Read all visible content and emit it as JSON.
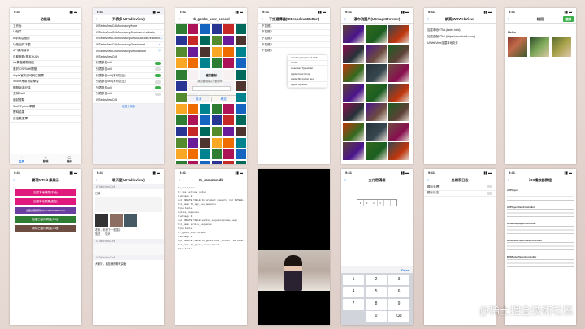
{
  "p1": {
    "time": "9:41",
    "title": "功能區",
    "items": [
      "工作台",
      "UI組件",
      "App商店推薦",
      "功能組件下載",
      "API調用接口",
      "自助服務(基本HUD)",
      "ios開發經驗總結",
      "基於IOS/Swift開發",
      "Apple官方認可商店推薦",
      "Xcode常用功能學習",
      "開發版本記錄",
      "支持Swift",
      "面試經驗",
      "Swift/Python學習",
      "實時結果",
      "自定義選擇"
    ],
    "tabs": [
      "主頁",
      "發現",
      "我的"
    ]
  },
  "p2": {
    "time": "9:41",
    "title": "列表多(UITableView)",
    "items": [
      "UITableViewCellAccessoryNone",
      "UITableViewCellAccessoryDisclosureIndicator",
      "UITableViewCellAccessoryDetailDisclosureButton",
      "UITableViewCellAccessoryCheckmark",
      "UITableViewCellAccessoryDetailButton",
      "UITableViewCell",
      "列表多的cell",
      "列表多的cell",
      "列表多的cell(不可交互)",
      "列表多的cell(不可交互)",
      "列表多的cell",
      "列表多的cell",
      "UITableViewCell"
    ],
    "footer": "我是分割線"
  },
  "p3": {
    "time": "9:41",
    "title": "tk_gunks_user_school",
    "dialog_title": "確認刪除",
    "dialog_sub": "確認要刪除這行數據嗎？",
    "cancel": "取消",
    "ok": "確定"
  },
  "p4": {
    "time": "9:41",
    "title": "下拉選擇器(UIDropdownButton)",
    "rows": [
      "下拉框1",
      "下拉框2",
      "下拉框3",
      "下拉框4",
      "下拉框5"
    ],
    "menu": [
      "Academy Engraved LET",
      "Al Nile",
      "American Typewriter",
      "Apple Color Emoji",
      "Apple SD Gothic Neo",
      "Apple Symbols"
    ]
  },
  "p5": {
    "time": "9:41",
    "title": "瀑布流圖片(UIImageBrowser)"
  },
  "p6": {
    "time": "9:41",
    "title": "網頁(WKWebView)",
    "lines": [
      "加載本地HTML(index.html)",
      "加載遠程HTML(https://www.baidu.com)",
      "UIWebView加載本地文件"
    ]
  },
  "p7": {
    "time": "9:41",
    "title": "相冊",
    "button": "選擇",
    "label": "Hello"
  },
  "p8": {
    "time": "9:41",
    "title": "實現MTKit 庫展示",
    "buttons": [
      "加載本地網頁(本地)",
      "加載本地網頁(遠程)",
      "加載遠程網頁https://www.baidu.com",
      "加載已緩存網頁(本地)",
      "清除已緩存網頁(本地)"
    ]
  },
  "p9": {
    "time": "9:41",
    "title": "聊天室(UITableView)",
    "header": "UITableViewCell",
    "sections": [
      "已讀",
      "UITableViewCell",
      "UITableViewCell",
      "UITableViewCell"
    ],
    "reply": "收到，你發了一張圖片",
    "footer": "大家好，這是我的聊天頁面",
    "opts": [
      "發送",
      "取消"
    ]
  },
  "p10": {
    "time": "9:41",
    "title": "tk_common.db",
    "lines": [
      "tk_user_info",
      "tk_ios_version_notes",
      "rootpage 2",
      "sql CREATE TABLE tk_product_moments (id INTEGER primary KEY AUTOINCREMENT,post TEXT)",
      "tbl_name tk_app_ios_moments",
      "type table",
      "sqlite_sequence",
      "rootpage 3",
      "sql CREATE TABLE sqlite_sequence(name,seq)",
      "tbl_name sqlite_sequence",
      "type table",
      "tk_gunks_user_school",
      "rootpage 4",
      "sql CREATE TABLE tk_gunks_user_school (id INTEGER primary KEY AUTOINCREMENT,text TEXT)",
      "tbl_name tk_gunks_user_school",
      "type table"
    ]
  },
  "p12": {
    "time": "9:41",
    "title": "支付密碼框",
    "keys": [
      "1",
      "2",
      "3",
      "4",
      "5",
      "6",
      "7",
      "8",
      "9",
      "",
      "0",
      "⌫"
    ],
    "done": "Done"
  },
  "p13": {
    "time": "9:41",
    "title": "坐標系日志",
    "rows": [
      "顯示坐標",
      "顯示日志"
    ]
  },
  "p14": {
    "time": "9:41",
    "title": "iOS播放器教程",
    "body": [
      "AVPlayer",
      "AVPlayerViewController",
      "AVMovieplayerController",
      "MPMoviePlayerViewController",
      "MPMoviePlayerController"
    ]
  },
  "watermark": "@稀土掘金技術社區",
  "colors": {
    "blue": "#1a73e8",
    "pink": "#e0197c",
    "green": "#3cb04a"
  }
}
